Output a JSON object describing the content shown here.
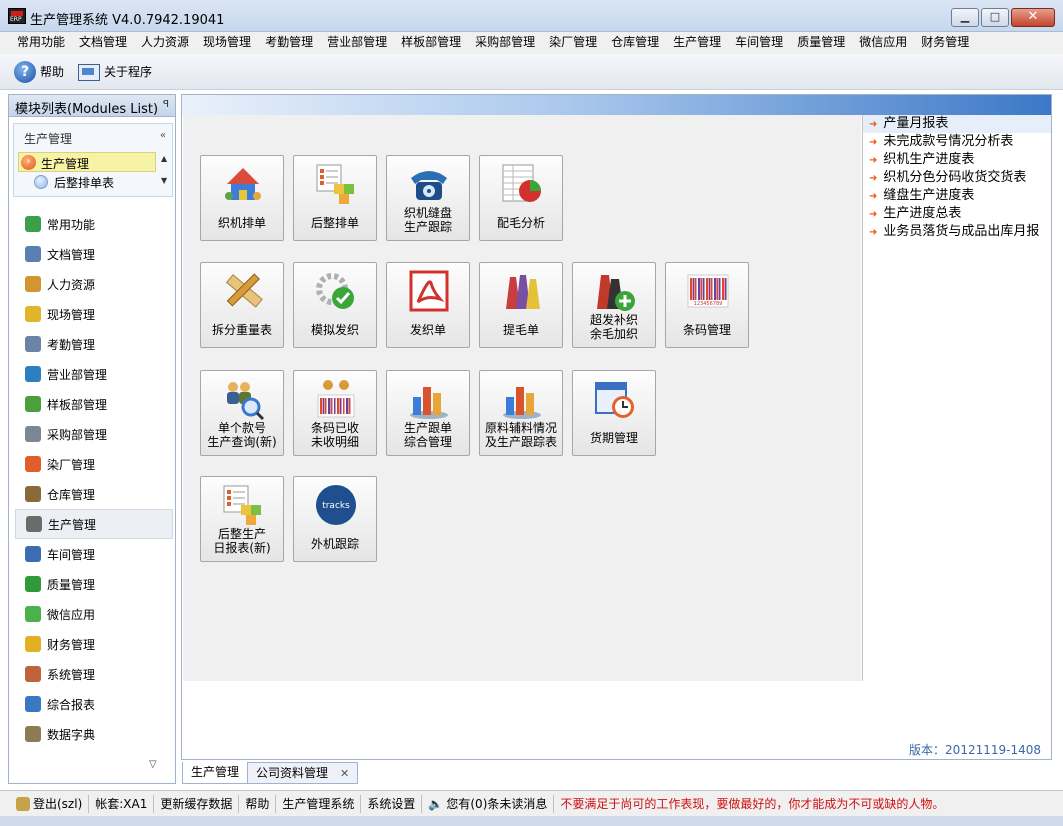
{
  "window": {
    "title": "生产管理系统 V4.0.7942.19041",
    "logo_text": "ERP",
    "minimize": "▁",
    "maximize": "□",
    "close": "✕"
  },
  "menu": [
    "常用功能",
    "文档管理",
    "人力资源",
    "现场管理",
    "考勤管理",
    "营业部管理",
    "样板部管理",
    "采购部管理",
    "染厂管理",
    "仓库管理",
    "生产管理",
    "车间管理",
    "质量管理",
    "微信应用",
    "财务管理"
  ],
  "toolbar": {
    "help": "帮助",
    "about": "关于程序"
  },
  "sidebar": {
    "title": "模块列表(Modules List)",
    "pin": "ꟼ",
    "group_title": "生产管理",
    "collapse": "«",
    "selected_node": "生产管理",
    "sub_node": "后整排单表",
    "more": "▽",
    "items": [
      {
        "label": "常用功能",
        "color": "#3aa049"
      },
      {
        "label": "文档管理",
        "color": "#5a7fb0"
      },
      {
        "label": "人力资源",
        "color": "#d1962f"
      },
      {
        "label": "现场管理",
        "color": "#e0b52a"
      },
      {
        "label": "考勤管理",
        "color": "#6d83a5"
      },
      {
        "label": "营业部管理",
        "color": "#2e7fbf"
      },
      {
        "label": "样板部管理",
        "color": "#4ca03c"
      },
      {
        "label": "采购部管理",
        "color": "#7b8794"
      },
      {
        "label": "染厂管理",
        "color": "#e05d2c"
      },
      {
        "label": "仓库管理",
        "color": "#8a6a3b"
      },
      {
        "label": "生产管理",
        "color": "#6b6b6b",
        "active": true
      },
      {
        "label": "车间管理",
        "color": "#3c6db3"
      },
      {
        "label": "质量管理",
        "color": "#2f9a3a"
      },
      {
        "label": "微信应用",
        "color": "#49b34a"
      },
      {
        "label": "财务管理",
        "color": "#e3b021"
      },
      {
        "label": "系统管理",
        "color": "#c0633a"
      },
      {
        "label": "综合报表",
        "color": "#3a78c2"
      },
      {
        "label": "数据字典",
        "color": "#8c7b55"
      }
    ]
  },
  "tiles": [
    {
      "line1": "织机排单",
      "line2": "",
      "name": "tile-loom-scheduling",
      "icon": "house-people-icon",
      "color": "#d94b3a"
    },
    {
      "line1": "后整排单",
      "line2": "",
      "name": "tile-finishing-scheduling",
      "icon": "checklist-cubes-icon",
      "color": "#e8c53a"
    },
    {
      "line1": "织机缝盘",
      "line2": "生产跟踪",
      "name": "tile-loom-tracking",
      "icon": "telephone-icon",
      "color": "#2a6fb2"
    },
    {
      "line1": "配毛分析",
      "line2": "",
      "name": "tile-yarn-analysis",
      "icon": "spreadsheet-pie-icon",
      "color": "#d0312d"
    },
    {
      "line1": "拆分重量表",
      "line2": "",
      "name": "tile-split-weight",
      "icon": "pencil-ruler-icon",
      "color": "#d89b3a"
    },
    {
      "line1": "模拟发织",
      "line2": "",
      "name": "tile-simulate-issue",
      "icon": "gear-check-icon",
      "color": "#3aa63a"
    },
    {
      "line1": "发织单",
      "line2": "",
      "name": "tile-issue-order",
      "icon": "pdf-icon",
      "color": "#d2322d"
    },
    {
      "line1": "提毛单",
      "line2": "",
      "name": "tile-yarn-pick",
      "icon": "yarn-spools-icon",
      "color": "#7a4ea3"
    },
    {
      "line1": "超发补织",
      "line2": "余毛加织",
      "name": "tile-over-issue",
      "icon": "yarn-plus-icon",
      "color": "#c0392b"
    },
    {
      "line1": "条码管理",
      "line2": "",
      "name": "tile-barcode",
      "icon": "barcode-icon",
      "color": "#6b3fa0"
    },
    {
      "line1": "单个款号",
      "line2": "生产查询(新)",
      "name": "tile-style-query",
      "icon": "people-search-icon",
      "color": "#3a78d0"
    },
    {
      "line1": "条码已收",
      "line2": "未收明细",
      "name": "tile-barcode-received",
      "icon": "barcode-people-icon",
      "color": "#d89b3a"
    },
    {
      "line1": "生产跟单",
      "line2": "综合管理",
      "name": "tile-production-tracking",
      "icon": "bar-chart-icon",
      "color": "#d9532c"
    },
    {
      "line1": "原料辅料情况",
      "line2": "及生产跟踪表",
      "name": "tile-material-status",
      "icon": "bar-chart-icon",
      "color": "#d9532c"
    },
    {
      "line1": "货期管理",
      "line2": "",
      "name": "tile-delivery",
      "icon": "calendar-clock-icon",
      "color": "#3a6fc2"
    },
    {
      "line1": "后整生产",
      "line2": "日报表(新)",
      "name": "tile-finishing-daily",
      "icon": "checklist-cubes-icon",
      "color": "#e8c53a"
    },
    {
      "line1": "外机跟踪",
      "line2": "",
      "name": "tile-outsource-tracking",
      "icon": "tracks-logo-icon",
      "color": "#1f4f8f",
      "logo_text": "tracks"
    }
  ],
  "reports": [
    "产量月报表",
    "未完成款号情况分析表",
    "织机生产进度表",
    "织机分色分码收货交货表",
    "缝盘生产进度表",
    "生产进度总表",
    "业务员落货与成品出库月报"
  ],
  "version": "版本：20121119-1408",
  "tabs": [
    {
      "label": "生产管理",
      "active": true
    },
    {
      "label": "公司资料管理",
      "close": "✕"
    }
  ],
  "status": {
    "logout": "登出(szl)",
    "account": "帐套:XA1",
    "refresh_cache": "更新缓存数据",
    "help": "帮助",
    "system": "生产管理系统",
    "settings": "系统设置",
    "messages": "您有(0)条未读消息",
    "motto": "不要满足于尚可的工作表现，要做最好的，你才能成为不可或缺的人物。"
  }
}
